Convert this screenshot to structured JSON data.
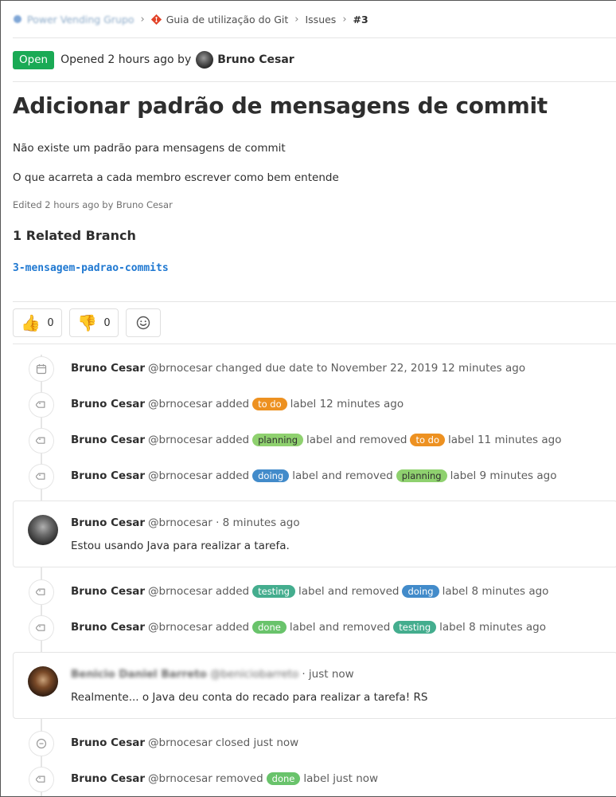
{
  "breadcrumb": {
    "group": "Power Vending Grupo",
    "project": "Guia de utilização do Git",
    "section": "Issues",
    "issue": "#3"
  },
  "header": {
    "status": "Open",
    "opened_text": "Opened 2 hours ago by",
    "author": "Bruno Cesar"
  },
  "issue": {
    "title": "Adicionar padrão de mensagens de commit",
    "description": [
      "Não existe um padrão para mensagens de commit",
      "O que acarreta a cada membro escrever como bem entende"
    ],
    "edited": "Edited 2 hours ago by Bruno Cesar",
    "related_branches_heading": "1 Related Branch",
    "branch": "3-mensagem-padrao-commits"
  },
  "awards": {
    "thumbs_up": {
      "emoji": "👍",
      "count": "0"
    },
    "thumbs_down": {
      "emoji": "👎",
      "count": "0"
    }
  },
  "colors": {
    "open": "#1aaa55",
    "link": "#1f78d1",
    "label_todo": "#ed9121",
    "label_planning": "#8fd16f",
    "label_doing": "#428bca",
    "label_testing": "#44ad8e",
    "label_done": "#69c36b"
  },
  "events": [
    {
      "icon": "calendar-icon",
      "author": "Bruno Cesar",
      "handle": "@brnocesar",
      "parts": [
        "changed due date to November 22, 2019 12 minutes ago"
      ]
    },
    {
      "icon": "label-icon",
      "author": "Bruno Cesar",
      "handle": "@brnocesar",
      "pre": "added",
      "label1": "to do",
      "mid": "label 12 minutes ago"
    },
    {
      "icon": "label-icon",
      "author": "Bruno Cesar",
      "handle": "@brnocesar",
      "pre": "added",
      "label1": "planning",
      "mid": "label and removed",
      "label2": "to do",
      "post": "label 11 minutes ago"
    },
    {
      "icon": "label-icon",
      "author": "Bruno Cesar",
      "handle": "@brnocesar",
      "pre": "added",
      "label1": "doing",
      "mid": "label and removed",
      "label2": "planning",
      "post": "label 9 minutes ago"
    },
    {
      "icon": "label-icon",
      "author": "Bruno Cesar",
      "handle": "@brnocesar",
      "pre": "added",
      "label1": "testing",
      "mid": "label and removed",
      "label2": "doing",
      "post": "label 8 minutes ago"
    },
    {
      "icon": "label-icon",
      "author": "Bruno Cesar",
      "handle": "@brnocesar",
      "pre": "added",
      "label1": "done",
      "mid": "label and removed",
      "label2": "testing",
      "post": "label 8 minutes ago"
    },
    {
      "icon": "closed-icon",
      "author": "Bruno Cesar",
      "handle": "@brnocesar",
      "text": "closed just now"
    },
    {
      "icon": "label-icon",
      "author": "Bruno Cesar",
      "handle": "@brnocesar",
      "pre": "removed",
      "label1": "done",
      "mid": "label just now"
    }
  ],
  "notes": [
    {
      "author": "Bruno Cesar",
      "meta": "@brnocesar · 8 minutes ago",
      "body": "Estou usando Java para realizar a tarefa."
    },
    {
      "author": "Benicio Daniel Barreto",
      "handle": "@beniciobarreto",
      "meta": "· just now",
      "body": "Realmente... o Java deu conta do recado para realizar a tarefa! RS"
    }
  ]
}
